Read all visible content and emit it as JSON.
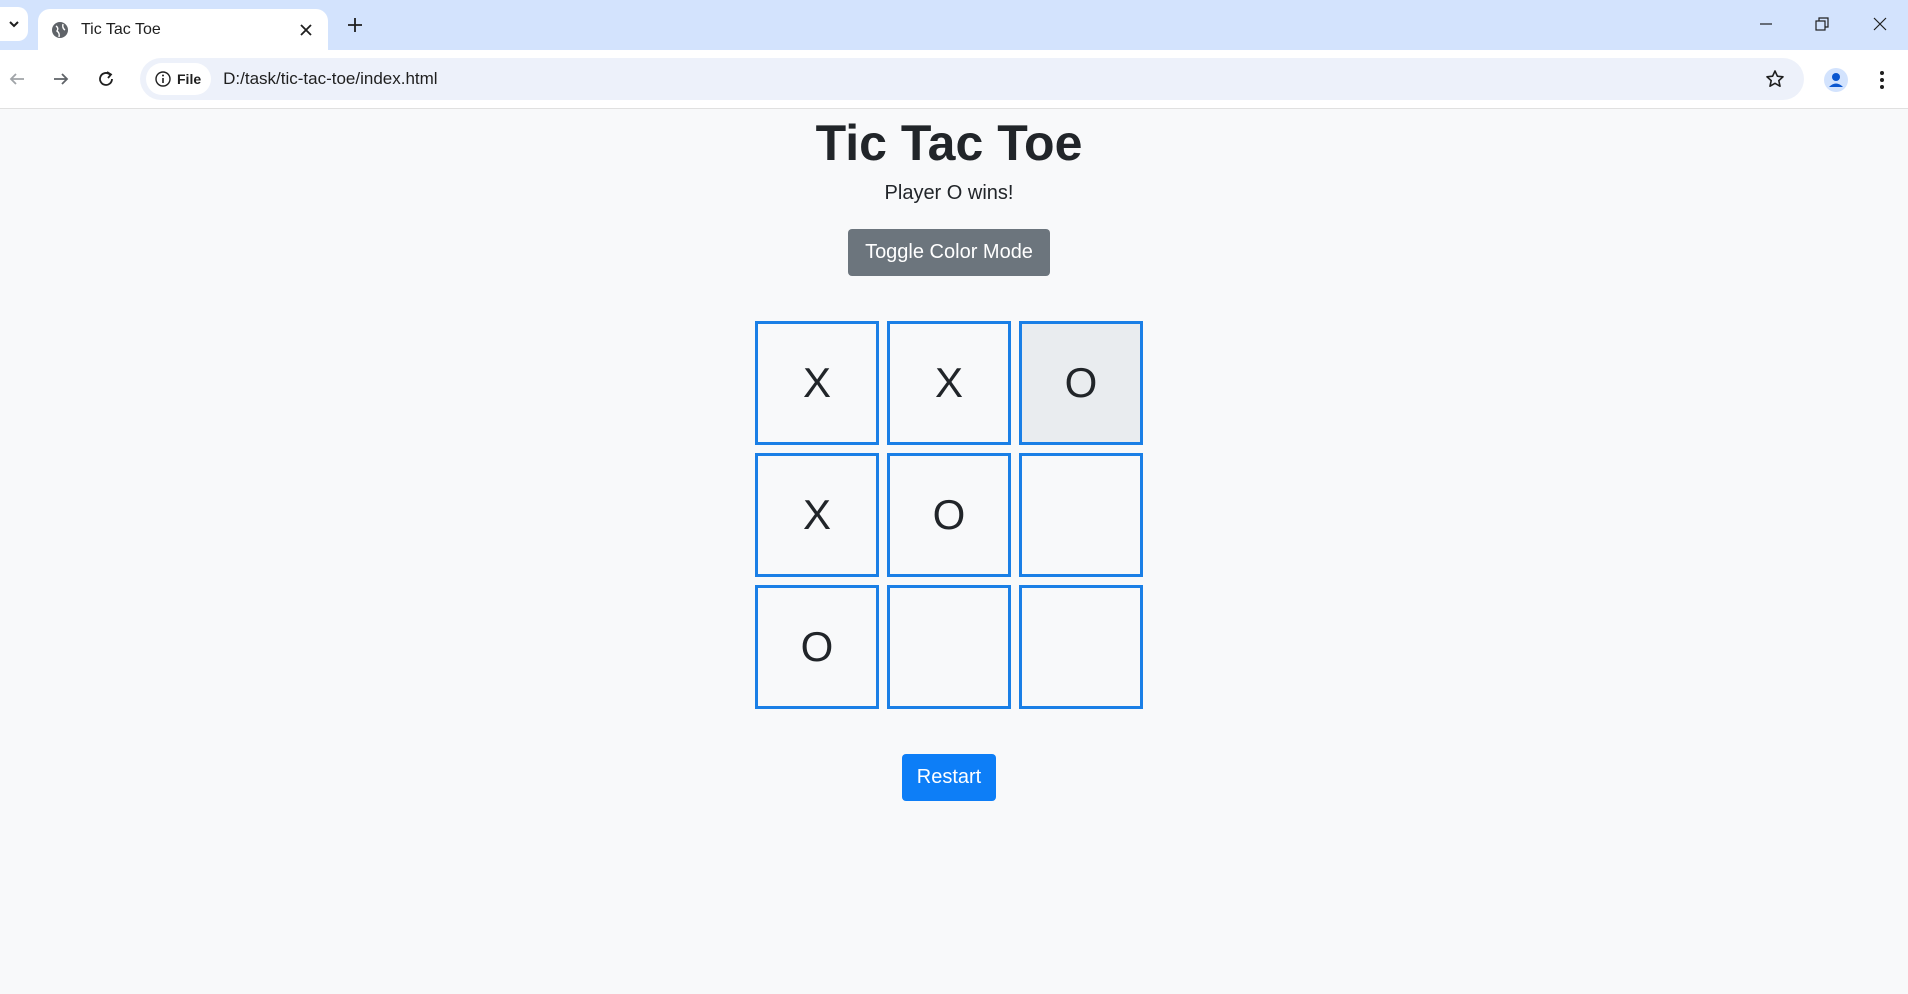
{
  "browser": {
    "tab_title": "Tic Tac Toe",
    "security_chip": "File",
    "url": "D:/task/tic-tac-toe/index.html"
  },
  "page": {
    "title": "Tic Tac Toe",
    "status": "Player O wins!",
    "toggle_label": "Toggle Color Mode",
    "restart_label": "Restart"
  },
  "board": {
    "cells": [
      "X",
      "X",
      "O",
      "X",
      "O",
      "",
      "O",
      "",
      ""
    ],
    "winning_cells": [
      2,
      4,
      6
    ]
  },
  "colors": {
    "cell_border": "#1a7fe6",
    "win_highlight": "#e9ecef",
    "toggle_button": "#6c757d",
    "restart_button": "#0d7ef7"
  }
}
